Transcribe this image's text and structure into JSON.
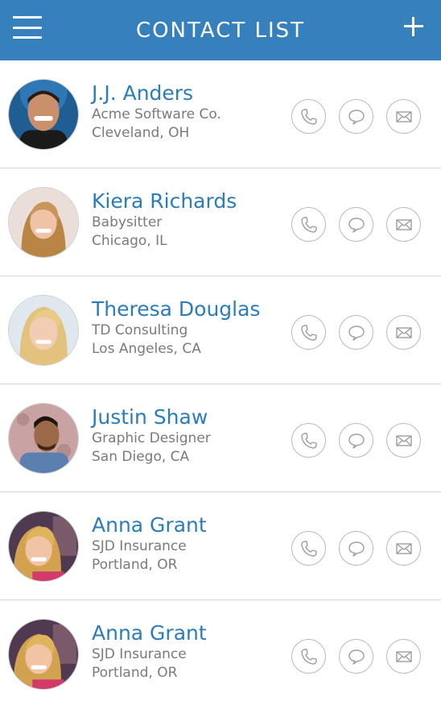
{
  "header": {
    "title": "CONTACT LIST",
    "bg_color": "#3580bd"
  },
  "icons": {
    "menu": "hamburger-icon",
    "add": "plus-icon",
    "call": "phone-icon",
    "message": "chat-bubble-icon",
    "email": "envelope-icon"
  },
  "colors": {
    "name": "#2a7dbb",
    "detail": "#7a7a7a",
    "icon_stroke": "#9e9e9e"
  },
  "contacts": [
    {
      "name": "J.J. Anders",
      "company": "Acme Software Co.",
      "location": "Cleveland, OH"
    },
    {
      "name": "Kiera Richards",
      "company": "Babysitter",
      "location": "Chicago, IL"
    },
    {
      "name": "Theresa Douglas",
      "company": "TD Consulting",
      "location": "Los Angeles, CA"
    },
    {
      "name": "Justin Shaw",
      "company": "Graphic Designer",
      "location": "San Diego, CA"
    },
    {
      "name": "Anna Grant",
      "company": "SJD Insurance",
      "location": "Portland, OR"
    },
    {
      "name": "Anna Grant",
      "company": "SJD Insurance",
      "location": "Portland, OR"
    }
  ]
}
